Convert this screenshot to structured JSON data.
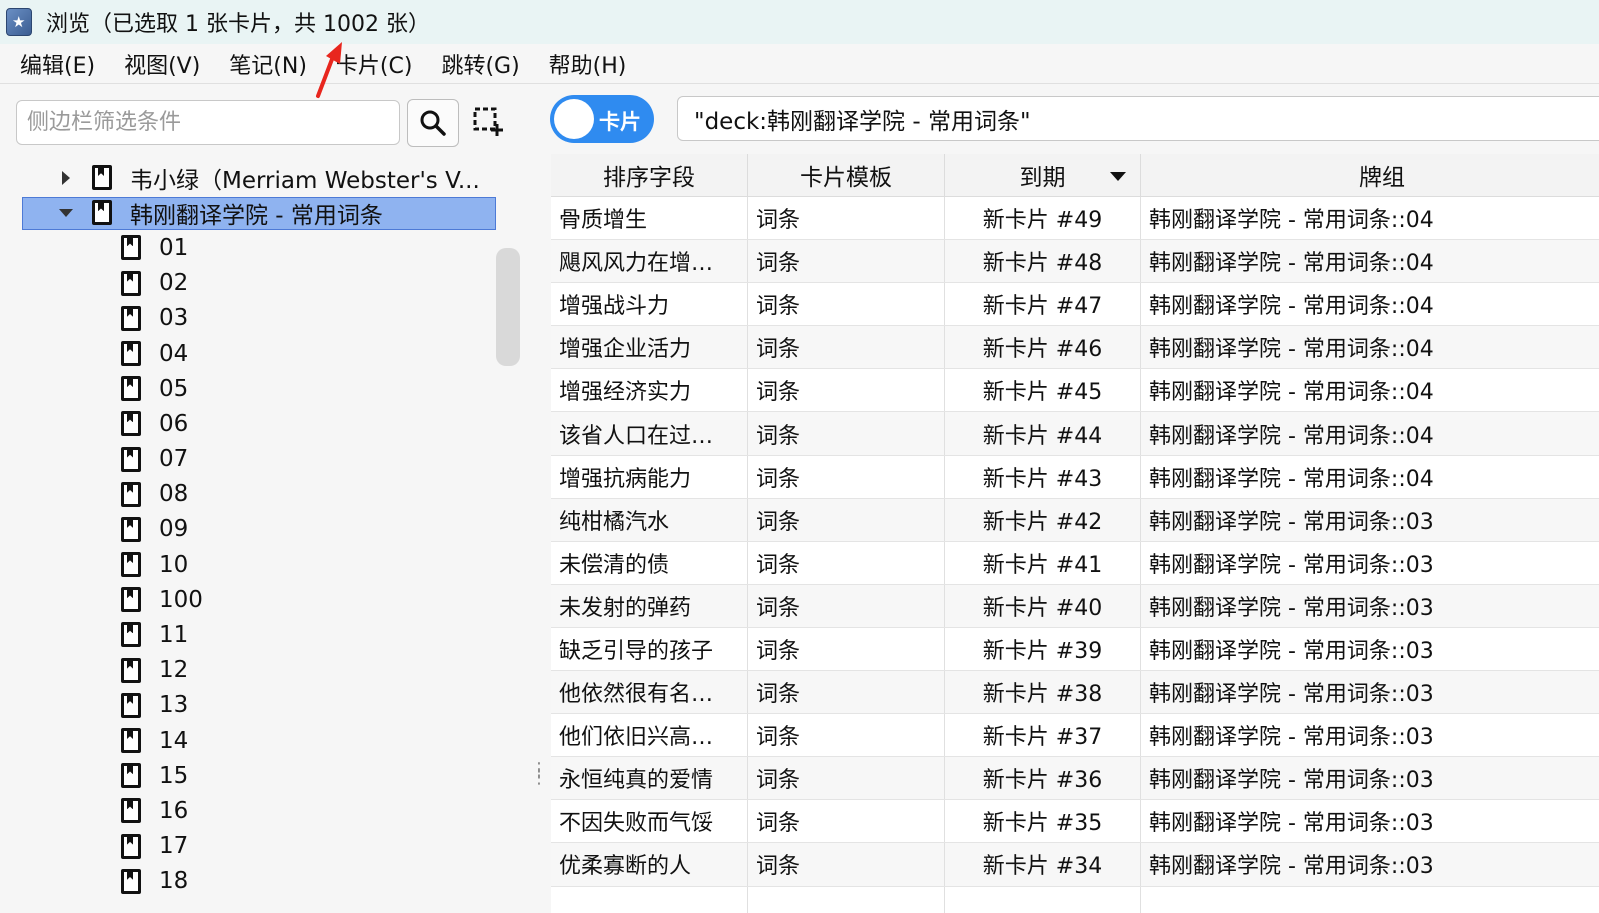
{
  "window": {
    "title": "浏览（已选取 1 张卡片，共 1002 张）"
  },
  "menu": [
    "编辑(E)",
    "视图(V)",
    "笔记(N)",
    "卡片(C)",
    "跳转(G)",
    "帮助(H)"
  ],
  "sidebar": {
    "search_placeholder": "侧边栏筛选条件",
    "tree": [
      {
        "label": "韦小绿（Merriam Webster's V...",
        "level": 0,
        "expander": "right"
      },
      {
        "label": "韩刚翻译学院 - 常用词条",
        "level": 0,
        "expander": "down",
        "selected": true
      },
      {
        "label": "01",
        "level": 1
      },
      {
        "label": "02",
        "level": 1
      },
      {
        "label": "03",
        "level": 1
      },
      {
        "label": "04",
        "level": 1
      },
      {
        "label": "05",
        "level": 1
      },
      {
        "label": "06",
        "level": 1
      },
      {
        "label": "07",
        "level": 1
      },
      {
        "label": "08",
        "level": 1
      },
      {
        "label": "09",
        "level": 1
      },
      {
        "label": "10",
        "level": 1
      },
      {
        "label": "100",
        "level": 1
      },
      {
        "label": "11",
        "level": 1
      },
      {
        "label": "12",
        "level": 1
      },
      {
        "label": "13",
        "level": 1
      },
      {
        "label": "14",
        "level": 1
      },
      {
        "label": "15",
        "level": 1
      },
      {
        "label": "16",
        "level": 1
      },
      {
        "label": "17",
        "level": 1
      },
      {
        "label": "18",
        "level": 1
      }
    ]
  },
  "toolbar": {
    "toggle_label": "卡片",
    "search_value": "\"deck:韩刚翻译学院 - 常用词条\""
  },
  "table": {
    "columns": [
      "排序字段",
      "卡片模板",
      "到期",
      "牌组"
    ],
    "rows": [
      [
        "骨质增生",
        "词条",
        "新卡片 #49",
        "韩刚翻译学院 - 常用词条::04"
      ],
      [
        "飓风风力在增…",
        "词条",
        "新卡片 #48",
        "韩刚翻译学院 - 常用词条::04"
      ],
      [
        "增强战斗力",
        "词条",
        "新卡片 #47",
        "韩刚翻译学院 - 常用词条::04"
      ],
      [
        "增强企业活力",
        "词条",
        "新卡片 #46",
        "韩刚翻译学院 - 常用词条::04"
      ],
      [
        "增强经济实力",
        "词条",
        "新卡片 #45",
        "韩刚翻译学院 - 常用词条::04"
      ],
      [
        "该省人口在过…",
        "词条",
        "新卡片 #44",
        "韩刚翻译学院 - 常用词条::04"
      ],
      [
        "增强抗病能力",
        "词条",
        "新卡片 #43",
        "韩刚翻译学院 - 常用词条::04"
      ],
      [
        "纯柑橘汽水",
        "词条",
        "新卡片 #42",
        "韩刚翻译学院 - 常用词条::03"
      ],
      [
        "未偿清的债",
        "词条",
        "新卡片 #41",
        "韩刚翻译学院 - 常用词条::03"
      ],
      [
        "未发射的弹药",
        "词条",
        "新卡片 #40",
        "韩刚翻译学院 - 常用词条::03"
      ],
      [
        "缺乏引导的孩子",
        "词条",
        "新卡片 #39",
        "韩刚翻译学院 - 常用词条::03"
      ],
      [
        "他依然很有名…",
        "词条",
        "新卡片 #38",
        "韩刚翻译学院 - 常用词条::03"
      ],
      [
        "他们依旧兴高…",
        "词条",
        "新卡片 #37",
        "韩刚翻译学院 - 常用词条::03"
      ],
      [
        "永恒纯真的爱情",
        "词条",
        "新卡片 #36",
        "韩刚翻译学院 - 常用词条::03"
      ],
      [
        "不因失败而气馁",
        "词条",
        "新卡片 #35",
        "韩刚翻译学院 - 常用词条::03"
      ],
      [
        "优柔寡断的人",
        "词条",
        "新卡片 #34",
        "韩刚翻译学院 - 常用词条::03"
      ],
      [
        "",
        "",
        "",
        ""
      ]
    ]
  },
  "colors": {
    "accent": "#2f8bf0",
    "selection": "#8fb3f0",
    "annotation": "#e8261e"
  },
  "icons": [
    "app-icon",
    "search-icon",
    "select-area-icon",
    "deck-icon",
    "expander-icon",
    "sort-desc-icon",
    "arrow-annotation-icon"
  ]
}
